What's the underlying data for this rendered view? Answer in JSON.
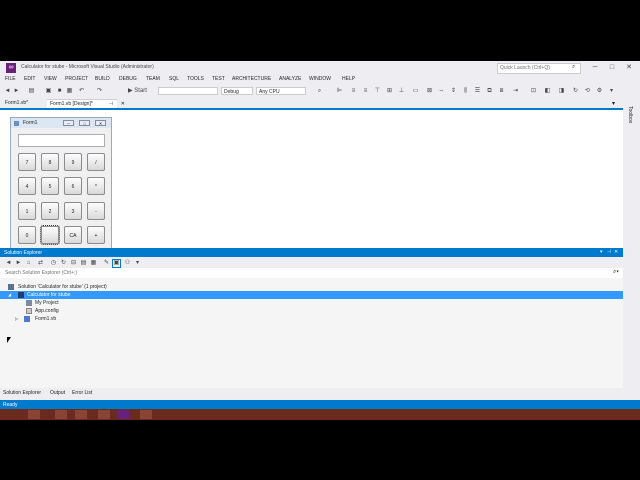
{
  "window": {
    "title": "Calculator for stube - Microsoft Visual Studio (Administrator)",
    "quick_launch_placeholder": "Quick Launch (Ctrl+Q)",
    "controls": {
      "minimize": "─",
      "maximize": "□",
      "close": "✕"
    }
  },
  "menu": [
    "FILE",
    "EDIT",
    "VIEW",
    "PROJECT",
    "BUILD",
    "DEBUG",
    "TEAM",
    "SQL",
    "TOOLS",
    "TEST",
    "ARCHITECTURE",
    "ANALYZE",
    "WINDOW",
    "HELP"
  ],
  "toolbar": {
    "start_label": "▶ Start",
    "config": "Debug",
    "platform": "Any CPU"
  },
  "tabs": [
    {
      "label": "Form1.vb*",
      "active": false
    },
    {
      "label": "Form1.vb [Design]*",
      "active": true
    }
  ],
  "toolbox_label": "Toolbox",
  "form": {
    "title": "Form1",
    "buttons": [
      [
        "7",
        "8",
        "9",
        "/"
      ],
      [
        "4",
        "5",
        "6",
        "*"
      ],
      [
        "1",
        "2",
        "3",
        "-"
      ],
      [
        "0",
        "",
        "CA",
        "+"
      ]
    ]
  },
  "solution_explorer": {
    "title": "Solution Explorer",
    "search_placeholder": "Search Solution Explorer (Ctrl+;)",
    "tree": [
      {
        "label": "Solution 'Calculator for stube' (1 project)",
        "level": 0,
        "selected": false,
        "expander": ""
      },
      {
        "label": "Calculator for stube",
        "level": 1,
        "selected": true,
        "expander": "◢"
      },
      {
        "label": "My Project",
        "level": 2,
        "selected": false,
        "expander": ""
      },
      {
        "label": "App.config",
        "level": 2,
        "selected": false,
        "expander": ""
      },
      {
        "label": "Form1.vb",
        "level": 2,
        "selected": false,
        "expander": "▷"
      }
    ]
  },
  "bottom_tabs": [
    "Solution Explorer",
    "Output",
    "Error List"
  ],
  "status": "Ready",
  "colors": {
    "accent": "#007acc",
    "selection": "#3399ff",
    "vs_purple": "#68217a"
  }
}
